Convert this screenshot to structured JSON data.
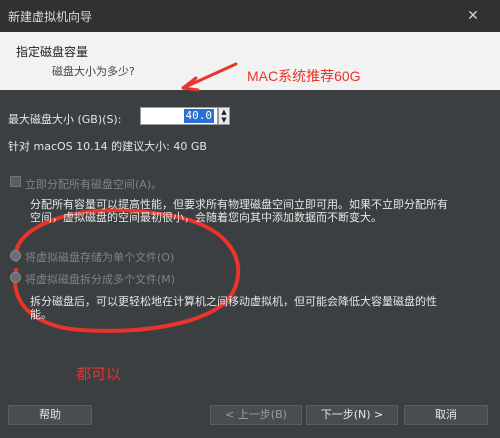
{
  "window": {
    "title": "新建虚拟机向导",
    "close_glyph": "✕"
  },
  "header": {
    "title": "指定磁盘容量",
    "subtitle": "磁盘大小为多少?"
  },
  "annotations": {
    "top": "MAC系统推荐60G",
    "bottom": "都可以",
    "color": "#e8342a"
  },
  "form": {
    "max_size_label": "最大磁盘大小 (GB)(S):",
    "size_value": "40.0",
    "recommend_text": "针对 macOS 10.14 的建议大小: 40 GB",
    "allocate_label": "立即分配所有磁盘空间(A)。",
    "allocate_desc_1": "分配所有容量可以提高性能，但要求所有物理磁盘空间立即可用。如果不立即分配所有",
    "allocate_desc_2": "空间，虚拟磁盘的空间最初很小，会随着您向其中添加数据而不断变大。",
    "single_file_label": "将虚拟磁盘存储为单个文件(O)",
    "split_file_label": "将虚拟磁盘拆分成多个文件(M)",
    "split_desc_1": "拆分磁盘后，可以更轻松地在计算机之间移动虚拟机，但可能会降低大容量磁盘的性",
    "split_desc_2": "能。"
  },
  "buttons": {
    "help": "帮助",
    "back": "< 上一步(B)",
    "next": "下一步(N) >",
    "cancel": "取消"
  }
}
